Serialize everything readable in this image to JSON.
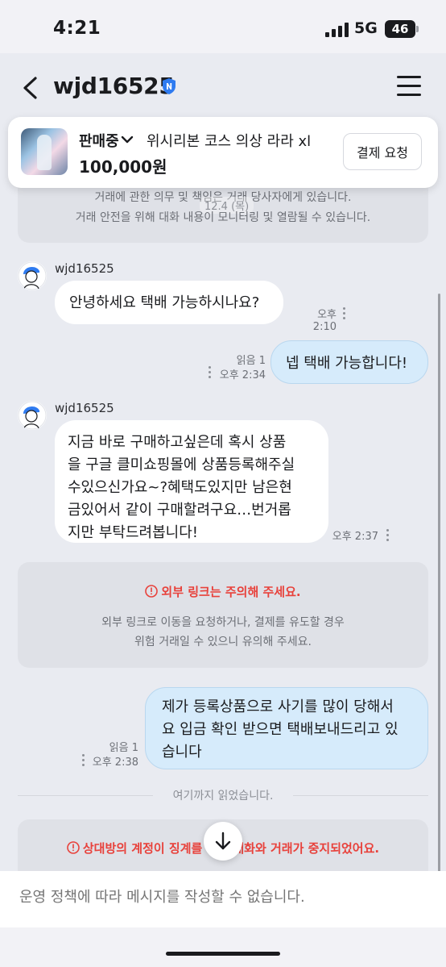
{
  "status_bar": {
    "time": "4:21",
    "network": "5G",
    "battery": "46"
  },
  "header": {
    "title": "wjd16525",
    "badge_icon": "verified-shield-icon",
    "back_icon": "chevron-left-icon",
    "menu_icon": "hamburger-menu-icon"
  },
  "product": {
    "status": "판매중",
    "title": "위시리본 코스 의상 라라 xl",
    "price": "100,000원",
    "pay_button": "결제 요청"
  },
  "notice": {
    "line1": "거래에 관한 의무 및 책임은 거래 당사자에게 있습니다.",
    "line2": "거래 안전을 위해 대화 내용이 모니터링 및 열람될 수 있습니다.",
    "date": "12.4 (목)"
  },
  "messages": [
    {
      "direction": "in",
      "sender": "wjd16525",
      "text": "안녕하세요 택배 가능하시나요?",
      "time": "오후 2:10"
    },
    {
      "direction": "out",
      "read": "읽음 1",
      "text": "넵 택배 가능합니다!",
      "time": "오후 2:34"
    },
    {
      "direction": "in",
      "sender": "wjd16525",
      "lines": [
        "지금 바로 구매하고싶은데 혹시 상품",
        "을 구글 클미쇼핑몰에 상품등록해주실",
        "수있으신가요~?혜택도있지만 남은현",
        "금있어서 같이 구매할려구요…번거롭",
        "지만 부탁드려봅니다!"
      ],
      "time": "오후 2:37"
    },
    {
      "direction": "out",
      "read": "읽음 1",
      "lines": [
        "제가 등록상품으로 사기를 많이 당해서",
        "요 입금 확인 받으면 택배보내드리고 있",
        "습니다"
      ],
      "time": "오후 2:38"
    }
  ],
  "warning": {
    "icon": "alert-circle-icon",
    "title": "외부 링크는 주의해 주세요.",
    "line1": "외부 링크로 이동을 요청하거나, 결제를 유도할 경우",
    "line2": "위험 거래일 수 있으니 유의해 주세요."
  },
  "read_marker": "여기까지 읽었습니다.",
  "suspension": {
    "icon": "alert-circle-icon",
    "text": "상대방의 계정이 징계를 받아 대화와 거래가 중지되었어요."
  },
  "input": {
    "placeholder": "운영 정책에 따라 메시지를 작성할 수 없습니다."
  },
  "colors": {
    "accent_blue": "#2f7bf0",
    "warning_red": "#e8413b",
    "outgoing_bubble": "#d6ebfb",
    "background": "#e9ebf1"
  }
}
